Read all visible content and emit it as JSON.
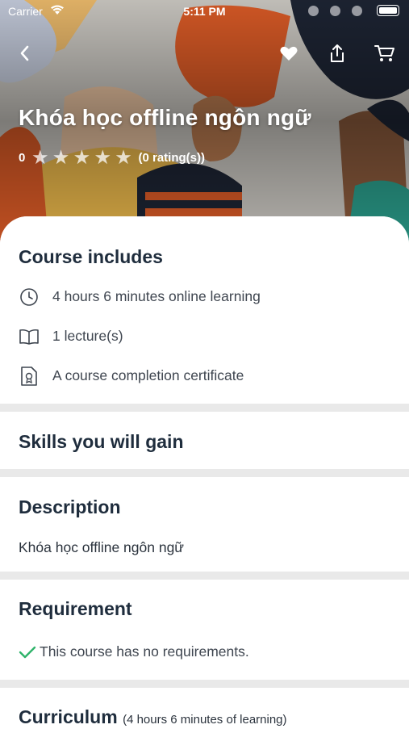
{
  "status_bar": {
    "carrier": "Carrier",
    "time": "5:11 PM"
  },
  "course": {
    "title": "Khóa học offline ngôn ngữ",
    "rating_value": "0",
    "rating_count": "(0 rating(s))",
    "stars_filled": 0,
    "stars_total": 5
  },
  "includes": {
    "heading": "Course includes",
    "items": [
      {
        "icon": "clock-icon",
        "text": "4 hours 6 minutes online learning"
      },
      {
        "icon": "book-icon",
        "text": "1 lecture(s)"
      },
      {
        "icon": "certificate-icon",
        "text": "A course completion certificate"
      }
    ]
  },
  "skills": {
    "heading": "Skills you will gain"
  },
  "description": {
    "heading": "Description",
    "text": "Khóa học offline ngôn ngữ"
  },
  "requirement": {
    "heading": "Requirement",
    "text": "This course has no requirements."
  },
  "curriculum": {
    "heading": "Curriculum",
    "summary": "(4 hours 6 minutes of learning)"
  },
  "colors": {
    "accent_check": "#2fb36a",
    "heading_text": "#1f2d3d",
    "separator": "#e9e9e9"
  }
}
